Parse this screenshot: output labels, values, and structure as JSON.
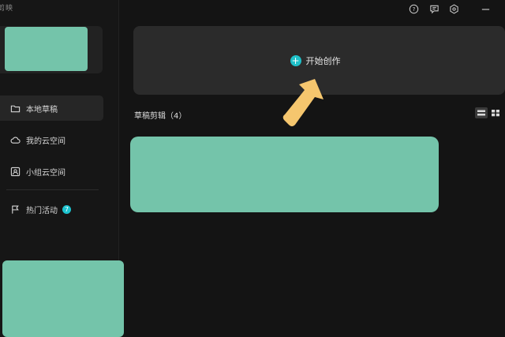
{
  "app": {
    "name": "剪映"
  },
  "sidebar": {
    "items": [
      {
        "label": "本地草稿",
        "icon": "folder-icon",
        "active": true
      },
      {
        "label": "我的云空间",
        "icon": "cloud-icon",
        "active": false
      },
      {
        "label": "小组云空间",
        "icon": "team-icon",
        "active": false
      },
      {
        "label": "热门活动",
        "icon": "flag-icon",
        "active": false,
        "badge": "7"
      }
    ]
  },
  "topbar": {
    "icons": [
      "help-icon",
      "feedback-icon",
      "settings-icon",
      "minimize-icon"
    ]
  },
  "main": {
    "create_label": "开始创作",
    "section_title": "草稿剪辑（4）",
    "view_modes": [
      "list-view-icon",
      "grid-view-icon"
    ]
  },
  "colors": {
    "accent": "#1fc0c8",
    "arrow": "#f5c66e",
    "redaction": "#74c4aa"
  }
}
